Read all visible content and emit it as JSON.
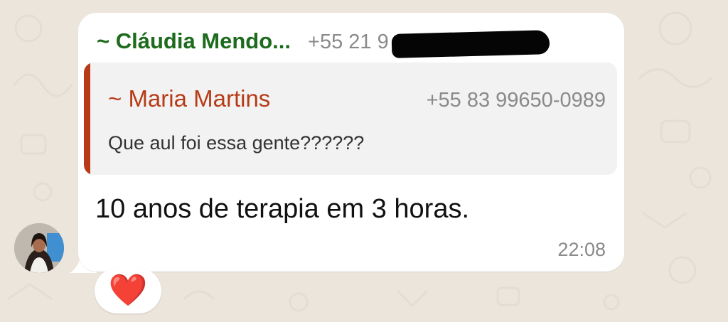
{
  "message": {
    "sender_name": "~ Cláudia Mendo...",
    "sender_phone": "+55 21 9",
    "quoted": {
      "name": "~ Maria Martins",
      "phone": "+55 83 99650-0989",
      "text": "Que aul foi essa gente??????"
    },
    "text": "10 anos de terapia em 3 horas.",
    "time": "22:08"
  },
  "reaction": {
    "emoji": "❤️"
  },
  "colors": {
    "background": "#ece5dc",
    "sender_name": "#1d6b1d",
    "quote_accent": "#b63b16",
    "meta_text": "#8a8a8a"
  }
}
